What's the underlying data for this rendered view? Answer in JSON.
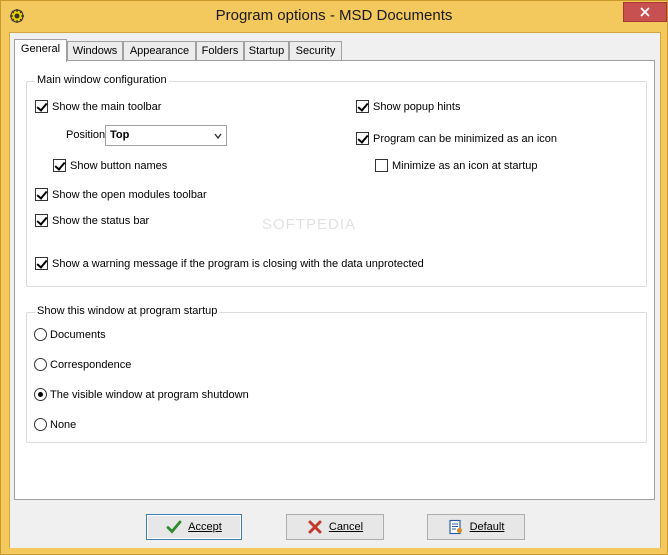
{
  "window": {
    "title": "Program options - MSD Documents"
  },
  "tabs": [
    {
      "label": "General",
      "active": true
    },
    {
      "label": "Windows",
      "active": false
    },
    {
      "label": "Appearance",
      "active": false
    },
    {
      "label": "Folders",
      "active": false
    },
    {
      "label": "Startup",
      "active": false
    },
    {
      "label": "Security",
      "active": false
    }
  ],
  "main_config": {
    "title": "Main window configuration",
    "show_main_toolbar": {
      "label": "Show the main toolbar",
      "checked": true
    },
    "position_label": "Position",
    "position_value": "Top",
    "show_button_names": {
      "label": "Show button names",
      "checked": true
    },
    "show_open_modules_toolbar": {
      "label": "Show the open modules toolbar",
      "checked": true
    },
    "show_status_bar": {
      "label": "Show the status bar",
      "checked": true
    },
    "show_warning": {
      "label": "Show a warning message if the program is closing with the data unprotected",
      "checked": true
    },
    "show_popup_hints": {
      "label": "Show popup hints",
      "checked": true
    },
    "can_minimize_icon": {
      "label": "Program can be minimized as an icon",
      "checked": true
    },
    "minimize_at_startup": {
      "label": "Minimize as an icon at startup",
      "checked": false
    }
  },
  "startup_window": {
    "title": "Show this window at program startup",
    "options": [
      {
        "label": "Documents",
        "selected": false
      },
      {
        "label": "Correspondence",
        "selected": false
      },
      {
        "label": "The visible window at program shutdown",
        "selected": true
      },
      {
        "label": "None",
        "selected": false
      }
    ]
  },
  "watermark": "SOFTPEDIA",
  "buttons": {
    "accept": "Accept",
    "cancel": "Cancel",
    "default": "Default"
  },
  "colors": {
    "frame": "#f3c85c",
    "close": "#c75050",
    "accept_icon": "#2e8b2e",
    "cancel_icon": "#c0392b"
  }
}
